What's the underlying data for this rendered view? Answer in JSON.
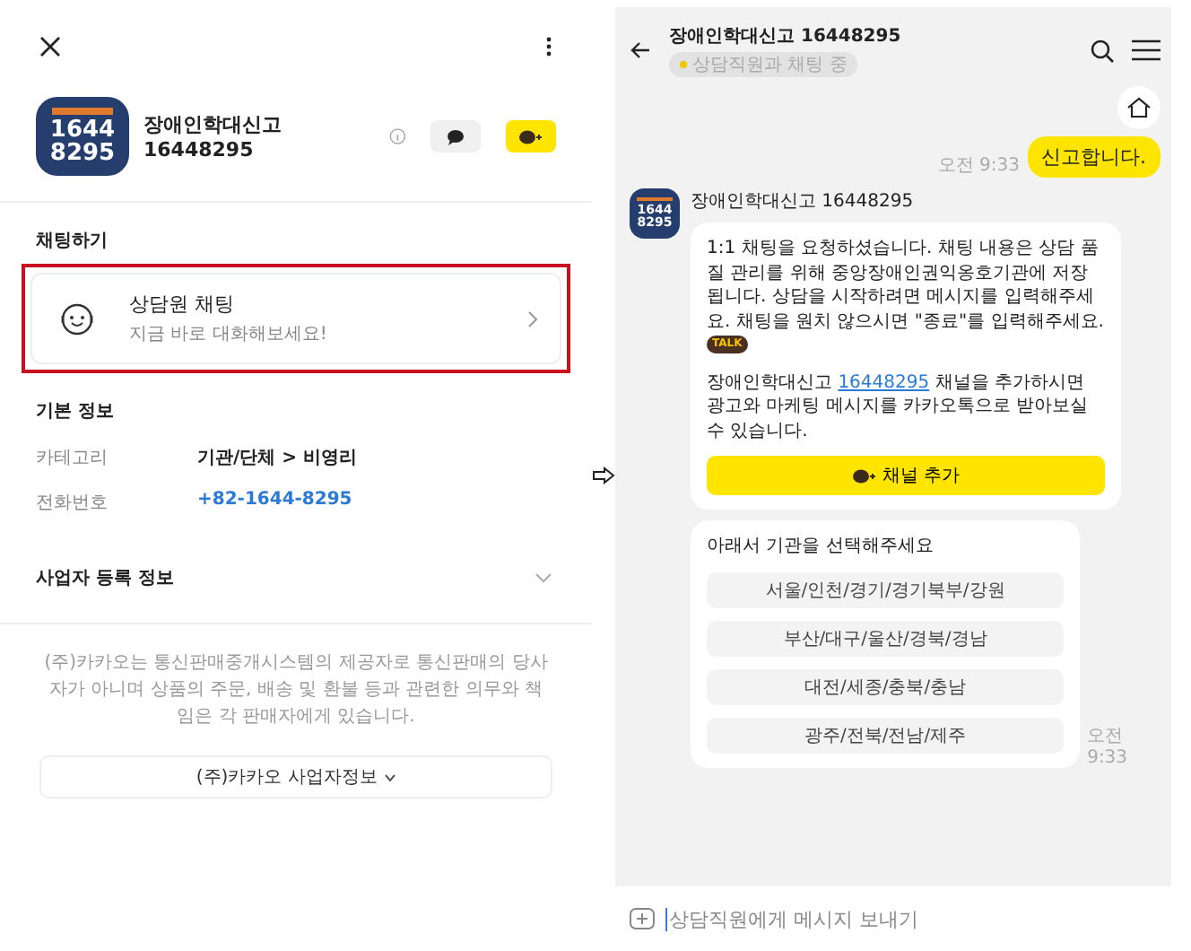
{
  "profile_screen": {
    "name": "장애인학대신고 16448295",
    "logo_digits": [
      "1644",
      "8295"
    ],
    "chat_section": {
      "title": "채팅하기",
      "card": {
        "title": "상담원 채팅",
        "subtitle": "지금 바로 대화해보세요!",
        "highlighted": true
      }
    },
    "basic_info": {
      "title": "기본 정보",
      "rows": [
        {
          "label": "카테고리",
          "value": "기관/단체 > 비영리",
          "kind": "text"
        },
        {
          "label": "전화번호",
          "value": "+82-1644-8295",
          "kind": "link"
        }
      ]
    },
    "business_info": {
      "title": "사업자 등록 정보",
      "expanded": false
    },
    "disclaimer": "(주)카카오는 통신판매중개시스템의 제공자로 통신판매의 당사자가 아니며 상품의 주문, 배송 및 환불 등과 관련한 의무와 책임은 각 판매자에게 있습니다.",
    "company_button": "(주)카카오 사업자정보"
  },
  "chat_screen": {
    "title": "장애인학대신고 16448295",
    "status": "상담직원과 채팅 중",
    "messages": [
      {
        "kind": "sent",
        "text": "신고합니다.",
        "time": "오전 9:33"
      },
      {
        "kind": "received",
        "sender": "장애인학대신고 16448295",
        "logo_digits": [
          "1644",
          "8295"
        ],
        "text": "1:1 채팅을 요청하셨습니다. 채팅 내용은 상담 품질 관리를 위해 중앙장애인권익옹호기관에 저장됩니다. 상담을 시작하려면 메시지를 입력해주세요. 채팅을 원치 않으시면 \"종료\"를 입력해주세요.",
        "emoticon": "TALK",
        "before": "장애인학대신고 ",
        "link": "16448295",
        "after": " 채널을 추가하시면 광고와 마케팅 메시지를 카카오톡으로 받아보실 수 있습니다.",
        "button": "채널 추가"
      },
      {
        "kind": "choices",
        "prompt": "아래서 기관을 선택해주세요",
        "options": [
          "서울/인천/경기/경기북부/강원",
          "부산/대구/울산/경북/경남",
          "대전/세종/충북/충남",
          "광주/전북/전남/제주"
        ],
        "time": "오전 9:33"
      }
    ],
    "input": {
      "placeholder": "상담직원에게 메시지 보내기"
    }
  }
}
